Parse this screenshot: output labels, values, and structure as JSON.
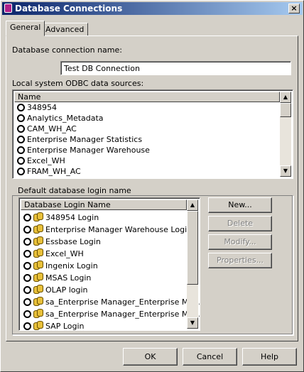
{
  "window": {
    "title": "Database Connections",
    "close": "×"
  },
  "tabs": [
    {
      "label": "General"
    },
    {
      "label": "Advanced"
    }
  ],
  "connection_name": {
    "label": "Database connection name:",
    "value": "Test DB Connection"
  },
  "odbc": {
    "label": "Local system ODBC data sources:",
    "column": "Name",
    "items": [
      "348954",
      "Analytics_Metadata",
      "CAM_WH_AC",
      "Enterprise Manager Statistics",
      "Enterprise Manager Warehouse",
      "Excel_WH",
      "FRAM_WH_AC"
    ]
  },
  "login": {
    "group_label": "Default database login name",
    "column": "Database Login Name",
    "items": [
      "348954 Login",
      "Enterprise Manager Warehouse Login",
      "Essbase Login",
      "Excel_WH",
      "Ingenix Login",
      "MSAS Login",
      "OLAP login",
      "sa_Enterprise Manager_Enterprise Ma...",
      "sa_Enterprise Manager_Enterprise Ma...",
      "SAP Login"
    ]
  },
  "side_buttons": {
    "new": "New...",
    "delete": "Delete",
    "modify": "Modify...",
    "properties": "Properties..."
  },
  "footer": {
    "ok": "OK",
    "cancel": "Cancel",
    "help": "Help"
  }
}
